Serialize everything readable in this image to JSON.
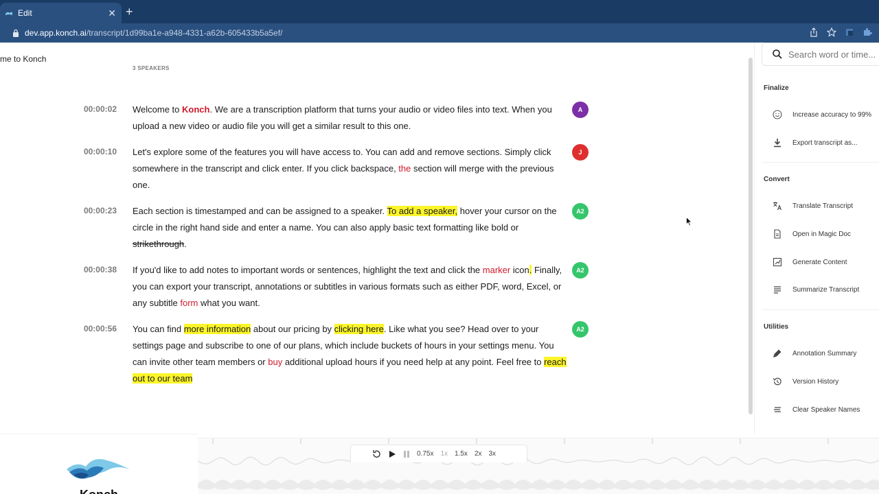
{
  "browser": {
    "tab_title": "Edit",
    "url_domain": "dev.app.konch.ai",
    "url_path": "/transcript/1d99ba1e-a948-4331-a62b-605433b5a5ef/"
  },
  "header": {
    "welcome_crumb": "me to Konch",
    "speakers_count": "3 SPEAKERS"
  },
  "transcript": [
    {
      "timestamp": "00:00:02",
      "speaker": "A",
      "speaker_color": "#7b2fa8",
      "segments": [
        {
          "t": "Welcome to ",
          "s": "b"
        },
        {
          "t": "Konch",
          "s": "bred"
        },
        {
          "t": ". We are a transcription platform that turns your audio or video files into text. When you upload a new video or audio file you will get a similar result to this one.",
          "s": ""
        }
      ]
    },
    {
      "timestamp": "00:00:10",
      "speaker": "J",
      "speaker_color": "#de2e2e",
      "segments": [
        {
          "t": "Let's explore some of the features you will have access to. You can add and remove sections. Simply click somewhere in the transcript and click enter. If you click backspace, ",
          "s": ""
        },
        {
          "t": "the",
          "s": "red"
        },
        {
          "t": " section will merge with the previous one.",
          "s": ""
        }
      ]
    },
    {
      "timestamp": "00:00:23",
      "speaker": "A2",
      "speaker_color": "#35c56b",
      "segments": [
        {
          "t": "Each section is timestamped and can be assigned to a speaker. ",
          "s": ""
        },
        {
          "t": "To add a speaker,",
          "s": "hl"
        },
        {
          "t": " hover your cursor on the circle in the right hand side and enter a name. You can also apply basic text formatting like ",
          "s": ""
        },
        {
          "t": "bold",
          "s": "b"
        },
        {
          "t": " or ",
          "s": ""
        },
        {
          "t": "strikethrough",
          "s": "strike"
        },
        {
          "t": ".",
          "s": ""
        }
      ]
    },
    {
      "timestamp": "00:00:38",
      "speaker": "A2",
      "speaker_color": "#35c56b",
      "segments": [
        {
          "t": "If you'd like to add notes to important words or sentences, highlight the text and click the ",
          "s": ""
        },
        {
          "t": "marker",
          "s": "red"
        },
        {
          "t": " icon",
          "s": ""
        },
        {
          "t": ".",
          "s": "hl"
        },
        {
          "t": " Finally, you can export your transcript, annotations or subtitles in various formats such as either PDF, word, Excel, or any subtitle ",
          "s": ""
        },
        {
          "t": "form",
          "s": "red"
        },
        {
          "t": " what you want.",
          "s": ""
        }
      ]
    },
    {
      "timestamp": "00:00:56",
      "speaker": "A2",
      "speaker_color": "#35c56b",
      "segments": [
        {
          "t": "You can find ",
          "s": ""
        },
        {
          "t": "more information",
          "s": "hl"
        },
        {
          "t": " about our pricing by ",
          "s": ""
        },
        {
          "t": "clicking here",
          "s": "hl"
        },
        {
          "t": ". Like what you see? Head over to your settings page and subscribe to one of our plans, which include buckets of hours in your settings menu. You can invite other team members or ",
          "s": ""
        },
        {
          "t": "buy",
          "s": "red"
        },
        {
          "t": " additional upload hours if you need help at any point. Feel free to ",
          "s": ""
        },
        {
          "t": "reach out to our team",
          "s": "hl"
        }
      ]
    }
  ],
  "sidebar": {
    "search_placeholder": "Search word or time...",
    "finalize_heading": "Finalize",
    "increase_accuracy": "Increase accuracy to 99%",
    "export_transcript": "Export transcript as...",
    "convert_heading": "Convert",
    "translate": "Translate Transcript",
    "magic_doc": "Open in Magic Doc",
    "generate": "Generate Content",
    "summarize": "Summarize Transcript",
    "utilities_heading": "Utilities",
    "annotation_summary": "Annotation Summary",
    "version_history": "Version History",
    "clear_speakers": "Clear Speaker Names"
  },
  "player": {
    "speed_075": "0.75x",
    "speed_1": "1x",
    "speed_15": "1.5x",
    "speed_2": "2x",
    "speed_3": "3x"
  },
  "logo": {
    "text": "Konch"
  },
  "colors": {
    "accent_red": "#d0182a",
    "highlight": "#fbf52a",
    "browser_bg": "#1a3b63"
  }
}
